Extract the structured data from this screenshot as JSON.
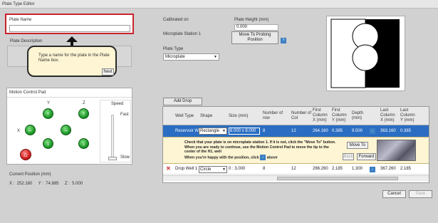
{
  "window": {
    "title": "Plate Type Editor"
  },
  "plate_name": {
    "label": "Plate Name",
    "value": ""
  },
  "plate_description": {
    "label": "Plate Description"
  },
  "tooltip": {
    "text": "Type a name for the plate in the Plate Name box.",
    "next_label": "Next"
  },
  "motion_pad": {
    "title": "Motion Control Pad",
    "axis_x": "X",
    "axis_y": "Y",
    "axis_z": "Z",
    "speed_label": "Speed",
    "fast_label": "Fast",
    "slow_label": "Slow"
  },
  "current_position": {
    "label": "Current Position (mm)",
    "values": "X :  252.160     Y :  74.885     Z :  5.000"
  },
  "calibrated_on": {
    "label": "Calibrated on"
  },
  "plate_height": {
    "label": "Plate Height (mm)",
    "value": "0.000"
  },
  "microplate_station": {
    "label": "Microplate Station 1"
  },
  "probe_button": {
    "label": "Move To Probing Position"
  },
  "plate_type": {
    "label": "Plate Type",
    "value": "Microplate"
  },
  "add_drop": {
    "label": "Add Drop"
  },
  "table": {
    "headers": [
      "Well Type",
      "Shape",
      "Size (mm)",
      "Number of row",
      "Number of Col",
      "First Column X (mm)",
      "First Column Y (mm)",
      "Depth (mm)",
      "Last Column X (mm)",
      "Last Column Y (mm)"
    ],
    "row1": {
      "well_type": "Reservoir W",
      "shape": "Rectangle",
      "size": "8.000 x 8.000",
      "rows": "8",
      "cols": "12",
      "first_x": "264.160",
      "first_y": "0.385",
      "depth": "9.500",
      "last_x": "363.160",
      "last_y": "0.385"
    },
    "detail": {
      "line1": "Check that your plate is on microplate station 1. If it is not, click the \"Move To\" button.",
      "line2": "When you are ready to continue, use the Motion Control Pad to move the tip to the center of the H1. well",
      "line3": "When you're happy with the position, click",
      "line3_end": "above",
      "move_to": "Move To",
      "back": "Back",
      "forward": "Forward"
    },
    "row2": {
      "well_type": "Drop Well 1",
      "shape": "Circle",
      "size": "0 : 3.000",
      "rows": "8",
      "cols": "12",
      "first_x": "266.260",
      "first_y": "2.185",
      "depth": "1.300",
      "last_x": "367.260",
      "last_y": "2.185"
    }
  },
  "footer": {
    "cancel": "Cancel",
    "save": "Save"
  }
}
